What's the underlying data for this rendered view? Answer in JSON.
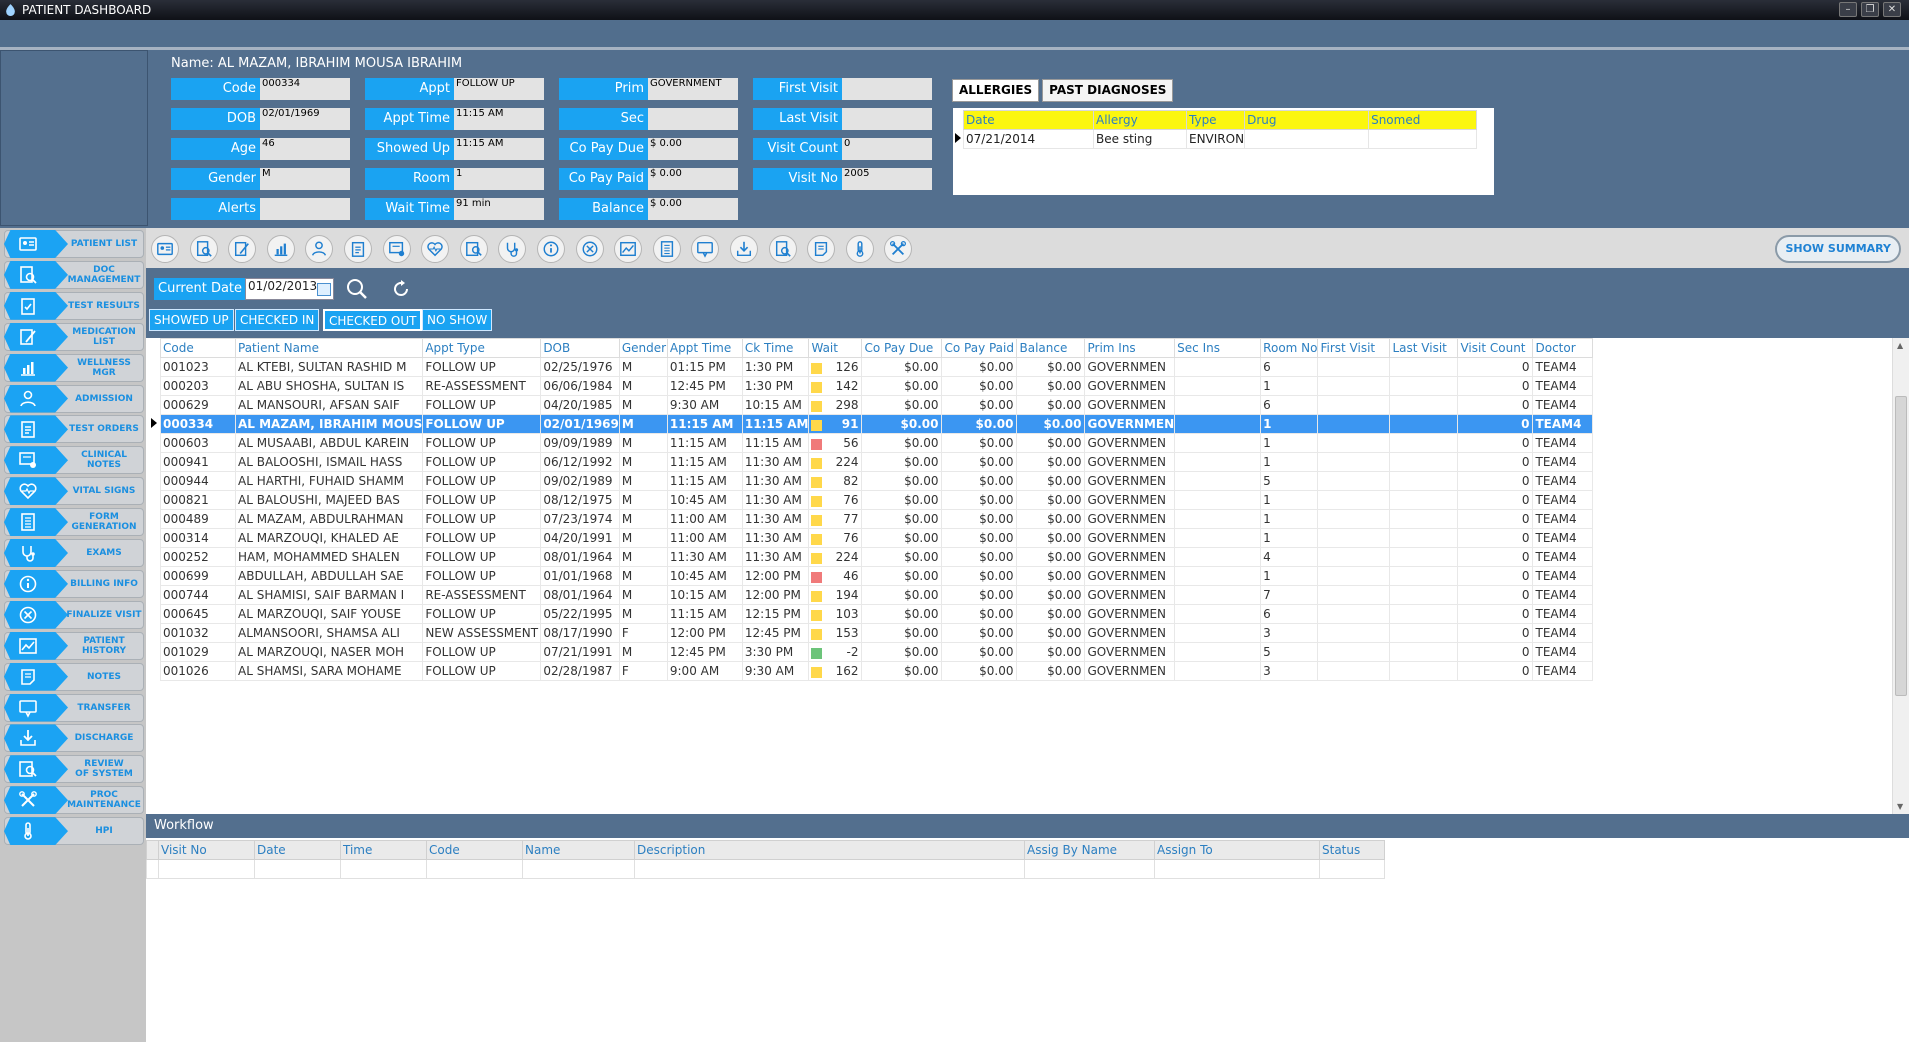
{
  "window": {
    "title": "PATIENT DASHBOARD"
  },
  "patient": {
    "name_label": "Name:",
    "name": "AL MAZAM, IBRAHIM MOUSA IBRAHIM",
    "fields": {
      "code": {
        "label": "Code",
        "value": "000334"
      },
      "dob": {
        "label": "DOB",
        "value": "02/01/1969"
      },
      "age": {
        "label": "Age",
        "value": "46"
      },
      "gender": {
        "label": "Gender",
        "value": "M"
      },
      "alerts": {
        "label": "Alerts",
        "value": ""
      },
      "appt": {
        "label": "Appt",
        "value": "FOLLOW UP"
      },
      "appt_time": {
        "label": "Appt Time",
        "value": "11:15 AM"
      },
      "showed_up": {
        "label": "Showed Up",
        "value": "11:15 AM"
      },
      "room": {
        "label": "Room",
        "value": "1"
      },
      "wait_time": {
        "label": "Wait Time",
        "value": "91 min"
      },
      "prim": {
        "label": "Prim",
        "value": "GOVERNMENT"
      },
      "sec": {
        "label": "Sec",
        "value": ""
      },
      "co_pay_due": {
        "label": "Co Pay Due",
        "value": "$ 0.00"
      },
      "co_pay_paid": {
        "label": "Co Pay Paid",
        "value": "$ 0.00"
      },
      "balance": {
        "label": "Balance",
        "value": "$ 0.00"
      },
      "first_visit": {
        "label": "First Visit",
        "value": ""
      },
      "last_visit": {
        "label": "Last Visit",
        "value": ""
      },
      "visit_count": {
        "label": "Visit Count",
        "value": "0"
      },
      "visit_no": {
        "label": "Visit No",
        "value": "2005"
      }
    }
  },
  "allergy_tabs": {
    "allergies": "ALLERGIES",
    "past_diagnoses": "PAST DIAGNOSES"
  },
  "allergies": {
    "columns": [
      "Date",
      "Allergy",
      "Type",
      "Drug",
      "Snomed"
    ],
    "rows": [
      [
        "07/21/2014",
        "Bee sting",
        "ENVIRON",
        "",
        ""
      ]
    ]
  },
  "sidebar": {
    "items": [
      {
        "label": "PATIENT LIST",
        "icon": "id-card-icon"
      },
      {
        "label": "DOC\nMANAGEMENT",
        "icon": "document-search-icon"
      },
      {
        "label": "TEST RESULTS",
        "icon": "clipboard-check-icon"
      },
      {
        "label": "MEDICATION\nLIST",
        "icon": "edit-list-icon"
      },
      {
        "label": "WELLNESS MGR",
        "icon": "chart-icon"
      },
      {
        "label": "ADMISSION",
        "icon": "person-icon"
      },
      {
        "label": "TEST ORDERS",
        "icon": "clipboard-icon"
      },
      {
        "label": "CLINICAL NOTES",
        "icon": "notes-icon"
      },
      {
        "label": "VITAL SIGNS",
        "icon": "heart-pulse-icon"
      },
      {
        "label": "FORM\nGENERATION",
        "icon": "form-icon"
      },
      {
        "label": "EXAMS",
        "icon": "stethoscope-icon"
      },
      {
        "label": "BILLING INFO",
        "icon": "info-icon"
      },
      {
        "label": "FINALIZE VISIT",
        "icon": "cancel-circle-icon"
      },
      {
        "label": "PATIENT HISTORY",
        "icon": "trend-chart-icon"
      },
      {
        "label": "NOTES",
        "icon": "note-icon"
      },
      {
        "label": "TRANSFER",
        "icon": "transfer-icon"
      },
      {
        "label": "DISCHARGE",
        "icon": "download-tray-icon"
      },
      {
        "label": "REVIEW\nOF SYSTEM",
        "icon": "review-icon"
      },
      {
        "label": "PROC\nMAINTENANCE",
        "icon": "tools-icon"
      },
      {
        "label": "HPI",
        "icon": "thermometer-icon"
      }
    ]
  },
  "toolbar": {
    "icons": [
      "id-card-icon",
      "document-search-icon",
      "edit-list-icon",
      "chart-icon",
      "person-icon",
      "clipboard-icon",
      "notes-icon",
      "heart-pulse-icon",
      "review-icon",
      "stethoscope-icon",
      "info-icon",
      "cancel-circle-icon",
      "trend-chart-icon",
      "form-icon",
      "transfer-icon",
      "download-tray-icon",
      "document-search-icon",
      "note-icon",
      "thermometer-icon",
      "tools-icon"
    ],
    "show_summary": "SHOW SUMMARY"
  },
  "filter": {
    "current_date_label": "Current Date",
    "current_date_value": "01/02/2013",
    "buttons": [
      "SHOWED UP",
      "CHECKED IN",
      "CHECKED OUT",
      "NO SHOW"
    ],
    "active_button": "CHECKED OUT"
  },
  "grid": {
    "columns": [
      "Code",
      "Patient Name",
      "Appt Type",
      "DOB",
      "Gender",
      "Appt Time",
      "Ck Time",
      "Wait",
      "Co Pay Due",
      "Co Pay Paid",
      "Balance",
      "Prim Ins",
      "Sec Ins",
      "Room No",
      "First Visit",
      "Last Visit",
      "Visit Count",
      "Doctor"
    ],
    "selected_index": 3,
    "rows": [
      [
        "001023",
        "AL KTEBI, SULTAN RASHID M",
        "FOLLOW UP",
        "02/25/1976",
        "M",
        "01:15 PM",
        "1:30 PM",
        "yellow",
        "126",
        "$0.00",
        "$0.00",
        "$0.00",
        "GOVERNMEN",
        "",
        "6",
        "",
        "",
        "0",
        "TEAM4"
      ],
      [
        "000203",
        "AL ABU SHOSHA, SULTAN IS",
        "RE-ASSESSMENT",
        "06/06/1984",
        "M",
        "12:45 PM",
        "1:30 PM",
        "yellow",
        "142",
        "$0.00",
        "$0.00",
        "$0.00",
        "GOVERNMEN",
        "",
        "1",
        "",
        "",
        "0",
        "TEAM4"
      ],
      [
        "000629",
        "AL MANSOURI, AFSAN SAIF",
        "FOLLOW UP",
        "04/20/1985",
        "M",
        "9:30 AM",
        "10:15 AM",
        "yellow",
        "298",
        "$0.00",
        "$0.00",
        "$0.00",
        "GOVERNMEN",
        "",
        "6",
        "",
        "",
        "0",
        "TEAM4"
      ],
      [
        "000334",
        "AL MAZAM, IBRAHIM MOUS",
        "FOLLOW UP",
        "02/01/1969",
        "M",
        "11:15 AM",
        "11:15 AM",
        "yellow",
        "91",
        "$0.00",
        "$0.00",
        "$0.00",
        "GOVERNMEN",
        "",
        "1",
        "",
        "",
        "0",
        "TEAM4"
      ],
      [
        "000603",
        "AL MUSAABI, ABDUL KAREIN",
        "FOLLOW UP",
        "09/09/1989",
        "M",
        "11:15 AM",
        "11:15 AM",
        "red",
        "56",
        "$0.00",
        "$0.00",
        "$0.00",
        "GOVERNMEN",
        "",
        "1",
        "",
        "",
        "0",
        "TEAM4"
      ],
      [
        "000941",
        "AL BALOOSHI, ISMAIL HASS",
        "FOLLOW UP",
        "06/12/1992",
        "M",
        "11:15 AM",
        "11:30 AM",
        "yellow",
        "224",
        "$0.00",
        "$0.00",
        "$0.00",
        "GOVERNMEN",
        "",
        "1",
        "",
        "",
        "0",
        "TEAM4"
      ],
      [
        "000944",
        "AL HARTHI, FUHAID SHAMM",
        "FOLLOW UP",
        "09/02/1989",
        "M",
        "11:15 AM",
        "11:30 AM",
        "yellow",
        "82",
        "$0.00",
        "$0.00",
        "$0.00",
        "GOVERNMEN",
        "",
        "5",
        "",
        "",
        "0",
        "TEAM4"
      ],
      [
        "000821",
        "AL BALOUSHI, MAJEED BAS",
        "FOLLOW UP",
        "08/12/1975",
        "M",
        "10:45 AM",
        "11:30 AM",
        "yellow",
        "76",
        "$0.00",
        "$0.00",
        "$0.00",
        "GOVERNMEN",
        "",
        "1",
        "",
        "",
        "0",
        "TEAM4"
      ],
      [
        "000489",
        "AL MAZAM, ABDULRAHMAN",
        "FOLLOW UP",
        "07/23/1974",
        "M",
        "11:00 AM",
        "11:30 AM",
        "yellow",
        "77",
        "$0.00",
        "$0.00",
        "$0.00",
        "GOVERNMEN",
        "",
        "1",
        "",
        "",
        "0",
        "TEAM4"
      ],
      [
        "000314",
        "AL MARZOUQI, KHALED AE",
        "FOLLOW UP",
        "04/20/1991",
        "M",
        "11:00 AM",
        "11:30 AM",
        "yellow",
        "76",
        "$0.00",
        "$0.00",
        "$0.00",
        "GOVERNMEN",
        "",
        "1",
        "",
        "",
        "0",
        "TEAM4"
      ],
      [
        "000252",
        "HAM, MOHAMMED SHALEN",
        "FOLLOW UP",
        "08/01/1964",
        "M",
        "11:30 AM",
        "11:30 AM",
        "yellow",
        "224",
        "$0.00",
        "$0.00",
        "$0.00",
        "GOVERNMEN",
        "",
        "4",
        "",
        "",
        "0",
        "TEAM4"
      ],
      [
        "000699",
        "ABDULLAH, ABDULLAH SAE",
        "FOLLOW UP",
        "01/01/1968",
        "M",
        "10:45 AM",
        "12:00 PM",
        "red",
        "46",
        "$0.00",
        "$0.00",
        "$0.00",
        "GOVERNMEN",
        "",
        "1",
        "",
        "",
        "0",
        "TEAM4"
      ],
      [
        "000744",
        "AL SHAMISI, SAIF BARMAN I",
        "RE-ASSESSMENT",
        "08/01/1964",
        "M",
        "10:15 AM",
        "12:00 PM",
        "yellow",
        "194",
        "$0.00",
        "$0.00",
        "$0.00",
        "GOVERNMEN",
        "",
        "7",
        "",
        "",
        "0",
        "TEAM4"
      ],
      [
        "000645",
        "AL MARZOUQI, SAIF YOUSE",
        "FOLLOW UP",
        "05/22/1995",
        "M",
        "11:15 AM",
        "12:15 PM",
        "yellow",
        "103",
        "$0.00",
        "$0.00",
        "$0.00",
        "GOVERNMEN",
        "",
        "6",
        "",
        "",
        "0",
        "TEAM4"
      ],
      [
        "001032",
        "ALMANSOORI, SHAMSA ALI",
        "NEW ASSESSMENT",
        "08/17/1990",
        "F",
        "12:00 PM",
        "12:45 PM",
        "yellow",
        "153",
        "$0.00",
        "$0.00",
        "$0.00",
        "GOVERNMEN",
        "",
        "3",
        "",
        "",
        "0",
        "TEAM4"
      ],
      [
        "001029",
        "AL MARZOUQI, NASER MOH",
        "FOLLOW UP",
        "07/21/1991",
        "M",
        "12:45 PM",
        "3:30 PM",
        "green",
        "-2",
        "$0.00",
        "$0.00",
        "$0.00",
        "GOVERNMEN",
        "",
        "5",
        "",
        "",
        "0",
        "TEAM4"
      ],
      [
        "001026",
        "AL SHAMSI, SARA MOHAME",
        "FOLLOW UP",
        "02/28/1987",
        "F",
        "9:00 AM",
        "9:30 AM",
        "yellow",
        "162",
        "$0.00",
        "$0.00",
        "$0.00",
        "GOVERNMEN",
        "",
        "3",
        "",
        "",
        "0",
        "TEAM4"
      ]
    ]
  },
  "status_colors": {
    "yellow": "#ffd84a",
    "red": "#f07a7a",
    "green": "#6cc47a"
  },
  "workflow": {
    "title": "Workflow",
    "columns": [
      "Visit No",
      "Date",
      "Time",
      "Code",
      "Name",
      "Description",
      "Assig By Name",
      "Assign To",
      "Status"
    ]
  },
  "colors": {
    "accent": "#1aa3f2",
    "panel": "#536f8e",
    "selection": "#3b96f2"
  }
}
